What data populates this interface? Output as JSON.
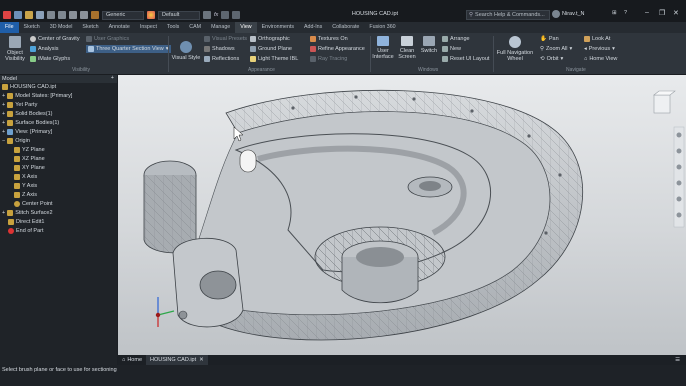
{
  "window": {
    "title": "HOUSING CAD.ipt",
    "search_placeholder": "Search Help & Commands...",
    "user": "Nirav.t_N"
  },
  "qat": {
    "appearance_combo": "Generic",
    "material_combo": "Default",
    "fx": "fx"
  },
  "tabs": [
    "File",
    "Sketch",
    "3D Model",
    "Sketch",
    "Annotate",
    "Inspect",
    "Tools",
    "CAM",
    "Manage",
    "View",
    "Environments",
    "Add-Ins",
    "Collaborate",
    "Fusion 360"
  ],
  "ribbon": {
    "visibility": {
      "object_visibility": "Object Visibility",
      "center_of_gravity": "Center of Gravity",
      "analysis": "Analysis",
      "imate_glyphs": "iMate Glyphs",
      "user_graphics": "User Graphics",
      "section_view": "Three Quarter Section View",
      "label": "Visibility"
    },
    "appearance": {
      "visual_style": "Visual Style",
      "visual_preset": "Visual Presets",
      "shadows": "Shadows",
      "reflections": "Reflections",
      "orthographic": "Orthographic",
      "ground_plane": "Ground Plane",
      "light_theme": "Light Theme IBL",
      "textures_on": "Textures On",
      "refine_appearance": "Refine Appearance",
      "ray_tracing": "Ray Tracing",
      "label": "Appearance"
    },
    "windows": {
      "user_interface": "User Interface",
      "clean_screen": "Clean Screen",
      "switch": "Switch",
      "arrange": "Arrange",
      "new": "New",
      "reset_ui": "Reset UI Layout",
      "label": "Windows"
    },
    "navigate": {
      "full_nav_wheel": "Full Navigation Wheel",
      "pan": "Pan",
      "zoom_all": "Zoom All",
      "orbit": "Orbit",
      "look_at": "Look At",
      "previous": "Previous",
      "home_view": "Home View",
      "label": "Navigate"
    }
  },
  "browser": {
    "title": "Model",
    "items": [
      "HOUSING CAD.ipt",
      "Model States: [Primary]",
      "Yet Party",
      "Solid Bodies(1)",
      "Surface Bodies(1)",
      "View: [Primary]",
      "Origin",
      "YZ Plane",
      "XZ Plane",
      "XY Plane",
      "X Axis",
      "Y Axis",
      "Z Axis",
      "Center Point",
      "Stitch Surface2",
      "Direct Edit1",
      "End of Part"
    ]
  },
  "doc_tabs": {
    "home": "Home",
    "active": "HOUSING CAD.ipt"
  },
  "status": {
    "text": "Select brush plane or face to use for sectioning"
  },
  "colors": {
    "accent": "#2f6fb4",
    "file_tab": "#1f5ea8",
    "ribbon": "#2f353c",
    "canvas_top": "#e8eaec"
  }
}
